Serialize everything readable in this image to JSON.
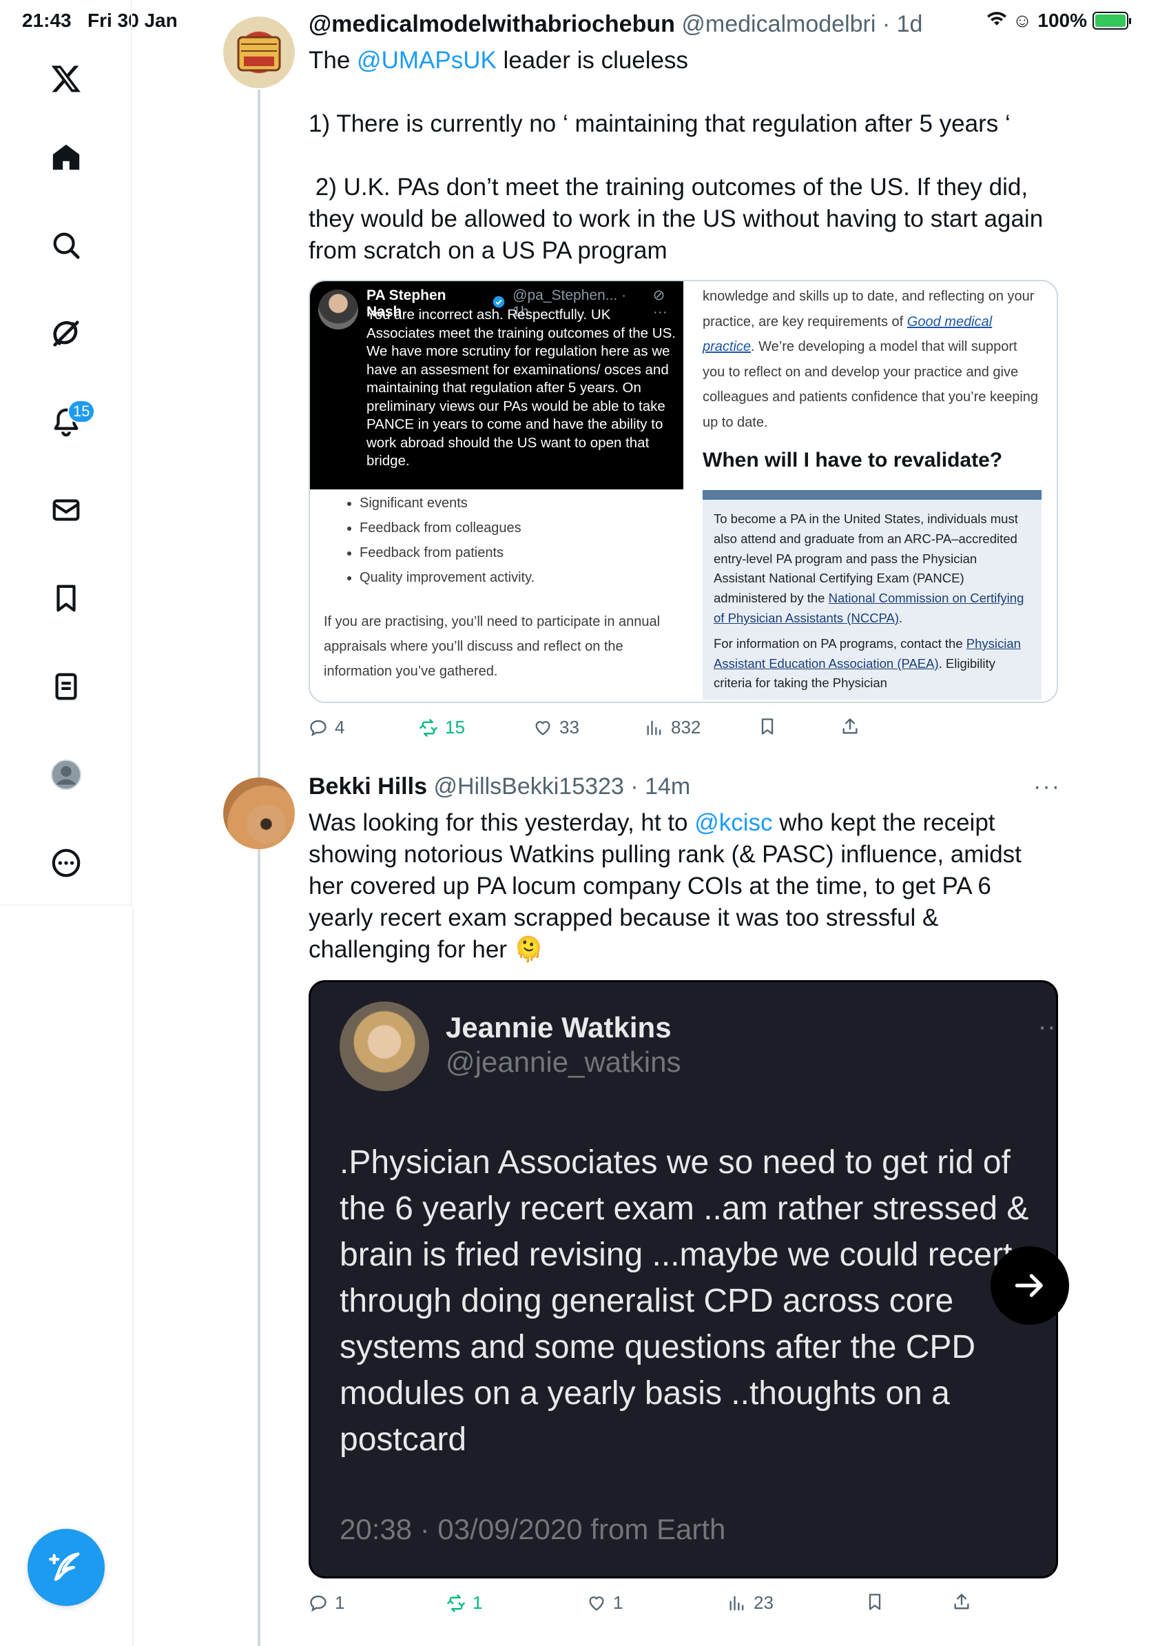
{
  "status_bar": {
    "time": "21:43",
    "date": "Fri 30 Jan",
    "battery": "100%"
  },
  "sidebar": {
    "notification_count": "15",
    "items": [
      "x-logo",
      "home-icon",
      "search-icon",
      "grok-icon",
      "notifications-icon",
      "messages-icon",
      "bookmarks-icon",
      "lists-icon",
      "profile-icon",
      "more-icon"
    ]
  },
  "tweet1": {
    "display_name": "@medicalmodelwithabriochebun",
    "handle": "@medicalmodelbri",
    "time": "· 1d",
    "text_line1_prefix": "The ",
    "text_line1_mention": "@UMAPsUK",
    "text_line1_suffix": " leader is clueless",
    "point1": "1) There is currently no ‘ maintaining that regulation after 5 years ‘",
    "point2": " 2) U.K. PAs don’t meet the training outcomes of the US. If they did, they would be allowed to work in the US without having to start again from scratch on a US PA program",
    "media": {
      "quoted_name": "PA Stephen Nash",
      "quoted_handle": "@pa_Stephen... · 1h",
      "quoted_text": "You are incorrect ash. Respectfully. UK Associates meet the training outcomes of the US. We have more scrutiny for regulation here as we have an assesment for examinations/ osces and maintaining that regulation after 5 years. On preliminary views our PAs would be able to take PANCE in years to come and have the ability to work abroad should the US want to open that bridge.",
      "bullets": [
        "Significant events",
        "Feedback from colleagues",
        "Feedback from patients",
        "Quality improvement activity."
      ],
      "paragraph": "If you are practising, you’ll need to participate in annual appraisals where you’ll discuss and reflect on the information you’ve gathered.",
      "right_text_a": "knowledge and skills up to date, and reflecting on your practice, are key requirements of ",
      "right_link": "Good medical practice",
      "right_text_b": ". We’re developing a model that will support you to reflect on and develop your practice and give colleagues and patients confidence that you’re keeping up to date.",
      "heading": "When will I have to revalidate?",
      "box_p1_a": "To become a PA in the United States, individuals must also attend and graduate from an ARC-PA–accredited entry-level PA program and pass the Physician Assistant National Certifying Exam (PANCE) administered by the ",
      "box_p1_link": "National Commission on Certifying of Physician Assistants (NCCPA)",
      "box_p1_b": ".",
      "box_p2_a": "For information on PA programs, contact the ",
      "box_p2_link": "Physician Assistant Education Association (PAEA)",
      "box_p2_b": ". Eligibility criteria for taking the Physician"
    },
    "actions": {
      "replies": "4",
      "reposts": "15",
      "likes": "33",
      "views": "832"
    }
  },
  "tweet2": {
    "display_name": "Bekki Hills",
    "handle": "@HillsBekki15323",
    "time": "· 14m",
    "text_prefix": "Was looking for this yesterday, ht to ",
    "text_mention": "@kcisc",
    "text_suffix": " who kept the receipt showing notorious Watkins pulling rank (& PASC) influence, amidst her covered up PA locum company COIs at the time, to get PA 6 yearly recert exam scrapped because it was too stressful & challenging for her 🫠",
    "media": {
      "name": "Jeannie Watkins",
      "handle": "@jeannie_watkins",
      "text": ".Physician Associates we so need to get rid of the 6 yearly recert exam ..am rather stressed & brain is fried revising ...maybe we could recert through doing generalist CPD across core systems and some questions after the CPD modules on a yearly basis ..thoughts on a postcard",
      "timestamp": "20:38 · 03/09/2020 from Earth"
    },
    "actions": {
      "replies": "1",
      "reposts": "1",
      "likes": "1",
      "views": "23"
    }
  },
  "colors": {
    "accent": "#1d9bf0",
    "repost": "#00ba7c",
    "text_secondary": "#536471"
  }
}
